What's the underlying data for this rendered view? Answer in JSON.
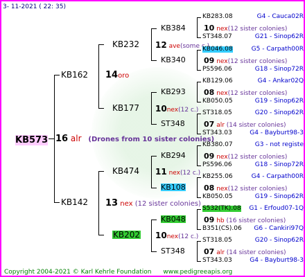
{
  "header": {
    "date": "3- 11-2021 ( 22: 35)"
  },
  "root": {
    "name": "KB573",
    "gen": "16",
    "code": "alr",
    "note": "(Drones from 10 sister colonies)"
  },
  "p1": {
    "upper": {
      "name": "KB162",
      "gen": "14",
      "code": "oro",
      "note": ""
    },
    "lower": {
      "name": "KB142",
      "gen": "13",
      "code": "nex",
      "note": "(12 sister colonies)"
    }
  },
  "p2": {
    "a": {
      "name": "KB232",
      "gen": "12",
      "code": "ave",
      "note": "(some c.)"
    },
    "b": {
      "name": "KB177",
      "gen": "10",
      "code": "nex",
      "note": "(12 c.)"
    },
    "c": {
      "name": "KB474",
      "gen": "11",
      "code": "nex",
      "note": "(12 c.)"
    },
    "d": {
      "name": "KB202",
      "gen": "10",
      "code": "nex",
      "note": "(12 c.)"
    }
  },
  "p3": {
    "a": {
      "name": "KB384",
      "gen": "10",
      "code": "nex",
      "note": "(12 sister colonies)"
    },
    "b": {
      "name": "KB340",
      "gen": "09",
      "code": "nex",
      "note": "(12 sister colonies)"
    },
    "c": {
      "name": "KB293",
      "gen": "08",
      "code": "nex",
      "note": "(12 sister colonies)"
    },
    "d": {
      "name": "ST348",
      "gen": "07",
      "code": "alr",
      "note": "(14 sister colonies)"
    },
    "e": {
      "name": "KB294",
      "gen": "09",
      "code": "nex",
      "note": "(12 sister colonies)"
    },
    "f": {
      "name": "KB108",
      "gen": "08",
      "code": "nex",
      "note": "(12 sister colonies)"
    },
    "g": {
      "name": "KB048",
      "gen": "09",
      "code": "hb",
      "note": "(16 sister colonies)"
    },
    "h": {
      "name": "ST348",
      "gen": "07",
      "code": "alr",
      "note": "(14 sister colonies)"
    }
  },
  "p4": [
    {
      "name": "KB283.08",
      "info": "G4 - Cauca02R"
    },
    {
      "name": "ST348.07",
      "info": "G21 - Sinop62R"
    },
    {
      "name": "KB046.08",
      "info": "G5 - Carpath00R"
    },
    {
      "name": "PS596.06",
      "info": "G18 - Sinop72R"
    },
    {
      "name": "KB129.06",
      "info": "G4 - Ankar02Q"
    },
    {
      "name": "KB050.05",
      "info": "G19 - Sinop62R"
    },
    {
      "name": "ST318.05",
      "info": "G20 - Sinop62R"
    },
    {
      "name": "ST343.03",
      "info": "G4 - Bayburt98-3"
    },
    {
      "name": "KB380.07",
      "info": "G3 - not registe"
    },
    {
      "name": "PS596.06",
      "info": "G18 - Sinop72R"
    },
    {
      "name": "KB255.06",
      "info": "G4 - Carpath00R"
    },
    {
      "name": "KB050.05",
      "info": "G19 - Sinop62R"
    },
    {
      "name": "S532(TK).08",
      "info": "G1 - Erfoud07-1Q"
    },
    {
      "name": "B351(CS).06",
      "info": "G6 - Cankiri97Q"
    },
    {
      "name": "ST318.05",
      "info": "G20 - Sinop62R"
    },
    {
      "name": "ST343.03",
      "info": "G4 - Bayburt98-3"
    }
  ],
  "footer": {
    "copyright": "Copyright 2004-2021 © Karl Kehrle Foundation",
    "url": "www.pedigreeapis.org"
  },
  "colors": {
    "border": "#ff00ff",
    "info": "#0000cc",
    "code": "#cc0000",
    "highlight_cyan": "#33ccff",
    "highlight_green": "#33cc33",
    "footer": "#008000"
  }
}
